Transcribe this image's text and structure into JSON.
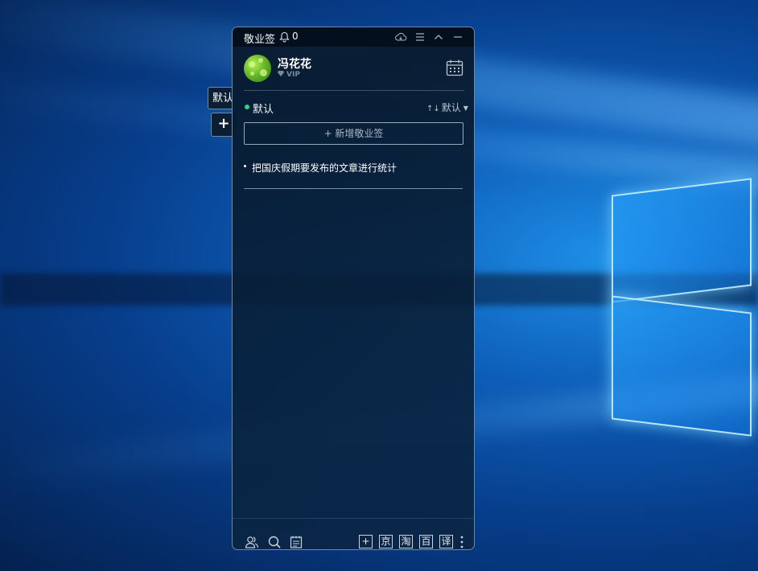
{
  "window": {
    "app_title": "敬业签",
    "notification_count": "0"
  },
  "user": {
    "name": "冯花花",
    "badge": "VIP"
  },
  "side_tabs": {
    "default_label": "默认",
    "add_label": "+"
  },
  "category": {
    "name": "默认",
    "sort_label": "默认",
    "sort_arrows": "↑↓"
  },
  "add_note_label": "+ 新增敬业签",
  "notes": [
    {
      "text": "把国庆假期要发布的文章进行统计"
    }
  ],
  "bottom_bar": {
    "extensions": [
      "+",
      "京",
      "淘",
      "百",
      "译"
    ]
  },
  "colors": {
    "status_dot": "#35d07a",
    "window_bg": "#081a2e",
    "desktop_bg": "#0d5db8"
  }
}
